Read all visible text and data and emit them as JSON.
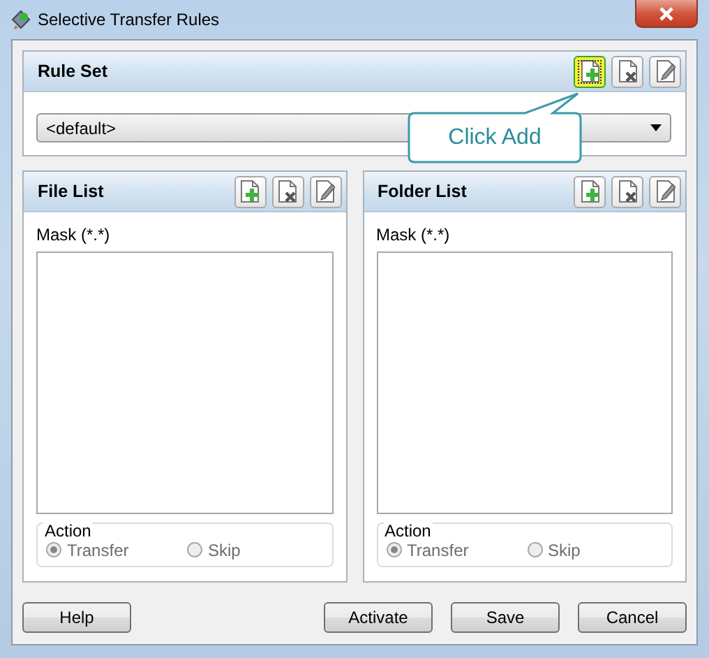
{
  "window": {
    "title": "Selective Transfer Rules"
  },
  "rule_set": {
    "title": "Rule Set",
    "tools": [
      {
        "kind": "add",
        "highlighted": true
      },
      {
        "kind": "delete",
        "highlighted": false
      },
      {
        "kind": "edit",
        "highlighted": false
      }
    ],
    "dropdown": {
      "value": "<default>"
    }
  },
  "panels": [
    {
      "title": "File List",
      "tools": [
        {
          "kind": "add",
          "highlighted": false
        },
        {
          "kind": "delete",
          "highlighted": false
        },
        {
          "kind": "edit",
          "highlighted": false
        }
      ],
      "mask_label": "Mask (*.*)",
      "action": {
        "label": "Action",
        "disabled": true,
        "options": [
          {
            "label": "Transfer",
            "selected": true
          },
          {
            "label": "Skip",
            "selected": false
          }
        ]
      }
    },
    {
      "title": "Folder List",
      "tools": [
        {
          "kind": "add",
          "highlighted": false
        },
        {
          "kind": "delete",
          "highlighted": false
        },
        {
          "kind": "edit",
          "highlighted": false
        }
      ],
      "mask_label": "Mask (*.*)",
      "action": {
        "label": "Action",
        "disabled": true,
        "options": [
          {
            "label": "Transfer",
            "selected": true
          },
          {
            "label": "Skip",
            "selected": false
          }
        ]
      }
    }
  ],
  "buttons": [
    {
      "label": "Help",
      "kind": "help"
    },
    {
      "label": "Activate",
      "kind": "activate"
    },
    {
      "label": "Save",
      "kind": "save"
    },
    {
      "label": "Cancel",
      "kind": "cancel"
    }
  ],
  "callout": {
    "text": "Click Add"
  }
}
